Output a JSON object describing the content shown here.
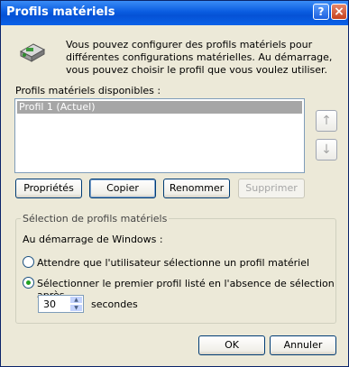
{
  "window": {
    "title": "Profils matériels"
  },
  "titlebar": {
    "help": "?",
    "close": "×"
  },
  "intro": {
    "text": "Vous pouvez configurer des profils matériels pour différentes configurations matérielles. Au démarrage, vous pouvez choisir le profil que vous voulez utiliser."
  },
  "profiles": {
    "label": "Profils matériels disponibles :",
    "items": [
      {
        "label": "Profil 1 (Actuel)",
        "selected": true
      }
    ],
    "move_up": "↑",
    "move_down": "↓"
  },
  "buttons": {
    "properties": "Propriétés",
    "copy": "Copier",
    "rename": "Renommer",
    "delete": "Supprimer",
    "ok": "OK",
    "cancel": "Annuler"
  },
  "selection": {
    "group_title": "Sélection de profils matériels",
    "startup_label": "Au démarrage de Windows  :",
    "option_wait": "Attendre que l'utilisateur sélectionne un profil matériel",
    "option_first": "Sélectionner le premier profil listé en l'absence de sélection après",
    "option_first_checked": true,
    "seconds_value": "30",
    "seconds_label": "secondes"
  },
  "colors": {
    "titlebar": "#0A5CE0",
    "dialog_bg": "#ECE9D8",
    "selection": "#A6A6A6"
  }
}
